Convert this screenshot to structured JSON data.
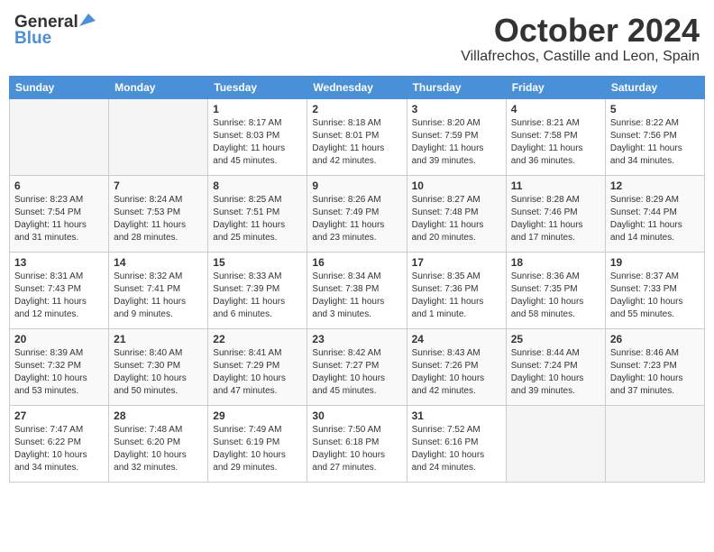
{
  "header": {
    "logo_general": "General",
    "logo_blue": "Blue",
    "month_title": "October 2024",
    "location": "Villafrechos, Castille and Leon, Spain"
  },
  "weekdays": [
    "Sunday",
    "Monday",
    "Tuesday",
    "Wednesday",
    "Thursday",
    "Friday",
    "Saturday"
  ],
  "weeks": [
    [
      {
        "day": "",
        "sunrise": "",
        "sunset": "",
        "daylight": ""
      },
      {
        "day": "",
        "sunrise": "",
        "sunset": "",
        "daylight": ""
      },
      {
        "day": "1",
        "sunrise": "Sunrise: 8:17 AM",
        "sunset": "Sunset: 8:03 PM",
        "daylight": "Daylight: 11 hours and 45 minutes."
      },
      {
        "day": "2",
        "sunrise": "Sunrise: 8:18 AM",
        "sunset": "Sunset: 8:01 PM",
        "daylight": "Daylight: 11 hours and 42 minutes."
      },
      {
        "day": "3",
        "sunrise": "Sunrise: 8:20 AM",
        "sunset": "Sunset: 7:59 PM",
        "daylight": "Daylight: 11 hours and 39 minutes."
      },
      {
        "day": "4",
        "sunrise": "Sunrise: 8:21 AM",
        "sunset": "Sunset: 7:58 PM",
        "daylight": "Daylight: 11 hours and 36 minutes."
      },
      {
        "day": "5",
        "sunrise": "Sunrise: 8:22 AM",
        "sunset": "Sunset: 7:56 PM",
        "daylight": "Daylight: 11 hours and 34 minutes."
      }
    ],
    [
      {
        "day": "6",
        "sunrise": "Sunrise: 8:23 AM",
        "sunset": "Sunset: 7:54 PM",
        "daylight": "Daylight: 11 hours and 31 minutes."
      },
      {
        "day": "7",
        "sunrise": "Sunrise: 8:24 AM",
        "sunset": "Sunset: 7:53 PM",
        "daylight": "Daylight: 11 hours and 28 minutes."
      },
      {
        "day": "8",
        "sunrise": "Sunrise: 8:25 AM",
        "sunset": "Sunset: 7:51 PM",
        "daylight": "Daylight: 11 hours and 25 minutes."
      },
      {
        "day": "9",
        "sunrise": "Sunrise: 8:26 AM",
        "sunset": "Sunset: 7:49 PM",
        "daylight": "Daylight: 11 hours and 23 minutes."
      },
      {
        "day": "10",
        "sunrise": "Sunrise: 8:27 AM",
        "sunset": "Sunset: 7:48 PM",
        "daylight": "Daylight: 11 hours and 20 minutes."
      },
      {
        "day": "11",
        "sunrise": "Sunrise: 8:28 AM",
        "sunset": "Sunset: 7:46 PM",
        "daylight": "Daylight: 11 hours and 17 minutes."
      },
      {
        "day": "12",
        "sunrise": "Sunrise: 8:29 AM",
        "sunset": "Sunset: 7:44 PM",
        "daylight": "Daylight: 11 hours and 14 minutes."
      }
    ],
    [
      {
        "day": "13",
        "sunrise": "Sunrise: 8:31 AM",
        "sunset": "Sunset: 7:43 PM",
        "daylight": "Daylight: 11 hours and 12 minutes."
      },
      {
        "day": "14",
        "sunrise": "Sunrise: 8:32 AM",
        "sunset": "Sunset: 7:41 PM",
        "daylight": "Daylight: 11 hours and 9 minutes."
      },
      {
        "day": "15",
        "sunrise": "Sunrise: 8:33 AM",
        "sunset": "Sunset: 7:39 PM",
        "daylight": "Daylight: 11 hours and 6 minutes."
      },
      {
        "day": "16",
        "sunrise": "Sunrise: 8:34 AM",
        "sunset": "Sunset: 7:38 PM",
        "daylight": "Daylight: 11 hours and 3 minutes."
      },
      {
        "day": "17",
        "sunrise": "Sunrise: 8:35 AM",
        "sunset": "Sunset: 7:36 PM",
        "daylight": "Daylight: 11 hours and 1 minute."
      },
      {
        "day": "18",
        "sunrise": "Sunrise: 8:36 AM",
        "sunset": "Sunset: 7:35 PM",
        "daylight": "Daylight: 10 hours and 58 minutes."
      },
      {
        "day": "19",
        "sunrise": "Sunrise: 8:37 AM",
        "sunset": "Sunset: 7:33 PM",
        "daylight": "Daylight: 10 hours and 55 minutes."
      }
    ],
    [
      {
        "day": "20",
        "sunrise": "Sunrise: 8:39 AM",
        "sunset": "Sunset: 7:32 PM",
        "daylight": "Daylight: 10 hours and 53 minutes."
      },
      {
        "day": "21",
        "sunrise": "Sunrise: 8:40 AM",
        "sunset": "Sunset: 7:30 PM",
        "daylight": "Daylight: 10 hours and 50 minutes."
      },
      {
        "day": "22",
        "sunrise": "Sunrise: 8:41 AM",
        "sunset": "Sunset: 7:29 PM",
        "daylight": "Daylight: 10 hours and 47 minutes."
      },
      {
        "day": "23",
        "sunrise": "Sunrise: 8:42 AM",
        "sunset": "Sunset: 7:27 PM",
        "daylight": "Daylight: 10 hours and 45 minutes."
      },
      {
        "day": "24",
        "sunrise": "Sunrise: 8:43 AM",
        "sunset": "Sunset: 7:26 PM",
        "daylight": "Daylight: 10 hours and 42 minutes."
      },
      {
        "day": "25",
        "sunrise": "Sunrise: 8:44 AM",
        "sunset": "Sunset: 7:24 PM",
        "daylight": "Daylight: 10 hours and 39 minutes."
      },
      {
        "day": "26",
        "sunrise": "Sunrise: 8:46 AM",
        "sunset": "Sunset: 7:23 PM",
        "daylight": "Daylight: 10 hours and 37 minutes."
      }
    ],
    [
      {
        "day": "27",
        "sunrise": "Sunrise: 7:47 AM",
        "sunset": "Sunset: 6:22 PM",
        "daylight": "Daylight: 10 hours and 34 minutes."
      },
      {
        "day": "28",
        "sunrise": "Sunrise: 7:48 AM",
        "sunset": "Sunset: 6:20 PM",
        "daylight": "Daylight: 10 hours and 32 minutes."
      },
      {
        "day": "29",
        "sunrise": "Sunrise: 7:49 AM",
        "sunset": "Sunset: 6:19 PM",
        "daylight": "Daylight: 10 hours and 29 minutes."
      },
      {
        "day": "30",
        "sunrise": "Sunrise: 7:50 AM",
        "sunset": "Sunset: 6:18 PM",
        "daylight": "Daylight: 10 hours and 27 minutes."
      },
      {
        "day": "31",
        "sunrise": "Sunrise: 7:52 AM",
        "sunset": "Sunset: 6:16 PM",
        "daylight": "Daylight: 10 hours and 24 minutes."
      },
      {
        "day": "",
        "sunrise": "",
        "sunset": "",
        "daylight": ""
      },
      {
        "day": "",
        "sunrise": "",
        "sunset": "",
        "daylight": ""
      }
    ]
  ]
}
